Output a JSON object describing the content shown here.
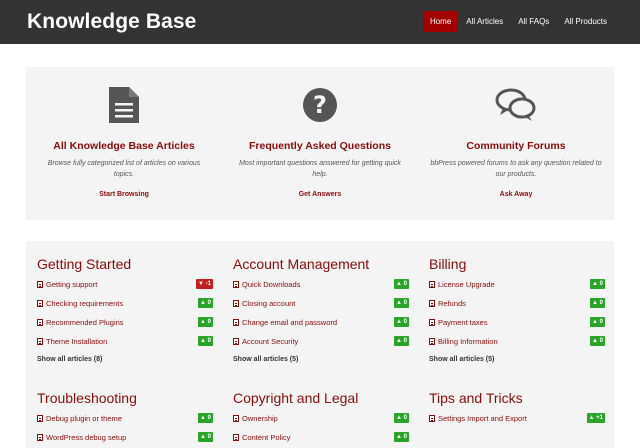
{
  "header": {
    "brand": "Knowledge Base",
    "nav": [
      "Home",
      "All Articles",
      "All FAQs",
      "All Products"
    ]
  },
  "features": [
    {
      "icon": "document-icon",
      "title": "All Knowledge Base Articles",
      "desc": "Browse fully categorized list of articles on various topics.",
      "link": "Start Browsing"
    },
    {
      "icon": "question-circle-icon",
      "title": "Frequently Asked Questions",
      "desc": "Most important questions answered for getting quick help.",
      "link": "Get Answers"
    },
    {
      "icon": "chat-bubbles-icon",
      "title": "Community Forums",
      "desc": "bbPress powered forums to ask any question related to our products.",
      "link": "Ask Away"
    }
  ],
  "categories": [
    {
      "title": "Getting Started",
      "show_all": "Show all articles (8)",
      "articles": [
        {
          "title": "Getting support",
          "votes": "-1"
        },
        {
          "title": "Checking requirements",
          "votes": "0"
        },
        {
          "title": "Recommended Plugins",
          "votes": "0"
        },
        {
          "title": "Theme Installation",
          "votes": "0"
        }
      ]
    },
    {
      "title": "Account Management",
      "show_all": "Show all articles (5)",
      "articles": [
        {
          "title": "Quick Downloads",
          "votes": "0"
        },
        {
          "title": "Closing account",
          "votes": "0"
        },
        {
          "title": "Change email and password",
          "votes": "0"
        },
        {
          "title": "Account Security",
          "votes": "0"
        }
      ]
    },
    {
      "title": "Billing",
      "show_all": "Show all articles (5)",
      "articles": [
        {
          "title": "License Upgrade",
          "votes": "0"
        },
        {
          "title": "Refunds",
          "votes": "0"
        },
        {
          "title": "Payment taxes",
          "votes": "0"
        },
        {
          "title": "Billing Information",
          "votes": "0"
        }
      ]
    },
    {
      "title": "Troubleshooting",
      "articles": [
        {
          "title": "Debug plugin or theme",
          "votes": "0"
        },
        {
          "title": "WordPress debug setup",
          "votes": "0"
        }
      ]
    },
    {
      "title": "Copyright and Legal",
      "articles": [
        {
          "title": "Ownership",
          "votes": "0"
        },
        {
          "title": "Content Policy",
          "votes": "0"
        }
      ]
    },
    {
      "title": "Tips and Tricks",
      "articles": [
        {
          "title": "Settings Import and Export",
          "votes": "+1"
        }
      ]
    }
  ],
  "colors": {
    "accent": "#8b0c0c",
    "nav_active": "#a30000",
    "topbar": "#333333",
    "vote_positive": "#2aa52a",
    "vote_negative": "#c0201e"
  }
}
